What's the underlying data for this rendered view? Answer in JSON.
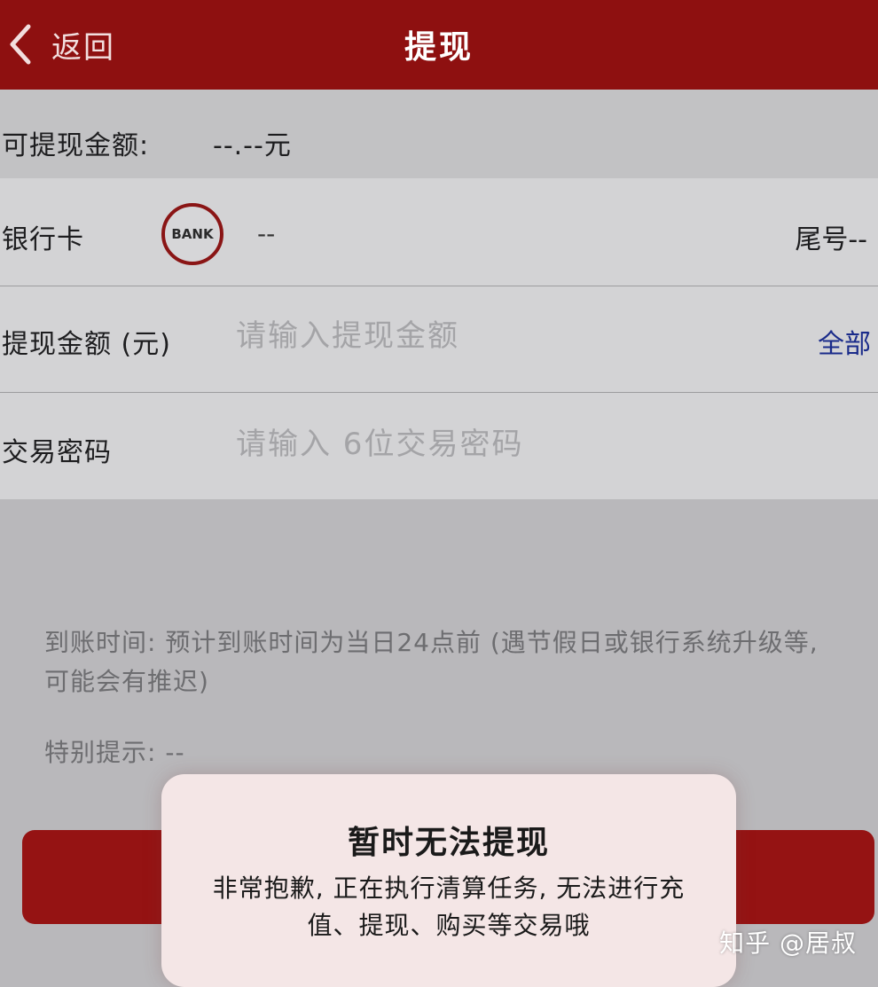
{
  "header": {
    "back_label": "返回",
    "title": "提现",
    "background_color": "#8e1010"
  },
  "balance": {
    "label": "可提现金额:",
    "value": "--.--元"
  },
  "bank_card": {
    "label": "银行卡",
    "logo_text": "BANK",
    "bank_name": "--",
    "tail_number": "尾号--"
  },
  "amount": {
    "label": "提现金额 (元)",
    "placeholder": "请输入提现金额",
    "value": "",
    "all_button": "全部"
  },
  "password": {
    "label": "交易密码",
    "placeholder": "请输入 6位交易密码",
    "value": ""
  },
  "notes": {
    "arrival_time": "到账时间: 预计到账时间为当日24点前 (遇节假日或银行系统升级等, 可能会有推迟)",
    "special_tip": "特别提示: --"
  },
  "dialog": {
    "title": "暂时无法提现",
    "message": "非常抱歉, 正在执行清算任务, 无法进行充值、提现、购买等交易哦"
  },
  "watermark": "知乎 @居叔",
  "colors": {
    "accent": "#951313",
    "link": "#1a2b8a"
  },
  "icons": {
    "back": "chevron-left-icon",
    "bank": "bank-logo-icon"
  }
}
